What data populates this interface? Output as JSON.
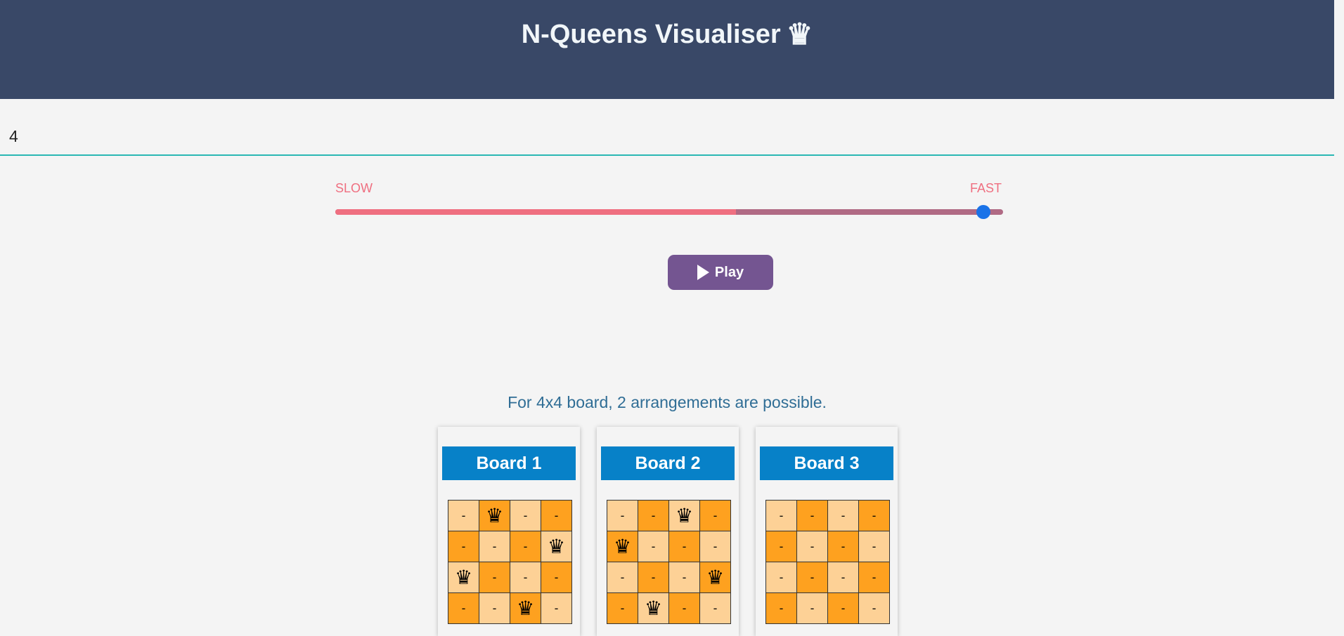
{
  "header": {
    "title": "N-Queens Visualiser",
    "crown_icon": "♛"
  },
  "n_input": {
    "value": "4"
  },
  "speed": {
    "slow_label": "SLOW",
    "fast_label": "FAST",
    "value_fraction": 0.97,
    "fill_fraction": 0.6
  },
  "play_button": {
    "label": "Play"
  },
  "result": {
    "text": "For 4x4 board, 2 arrangements are possible."
  },
  "colors": {
    "header_bg": "#394867",
    "board_title_bg": "#0781c8",
    "cell_light": "#fdd196",
    "cell_dark": "#fea11f",
    "play_bg": "#745591"
  },
  "boards": [
    {
      "title": "Board 1",
      "queens": [
        1,
        3,
        0,
        2
      ]
    },
    {
      "title": "Board 2",
      "queens": [
        2,
        0,
        3,
        1
      ]
    },
    {
      "title": "Board 3",
      "queens": [
        -1,
        -1,
        -1,
        -1
      ]
    }
  ],
  "cell": {
    "empty": "-",
    "queen": "♛"
  }
}
